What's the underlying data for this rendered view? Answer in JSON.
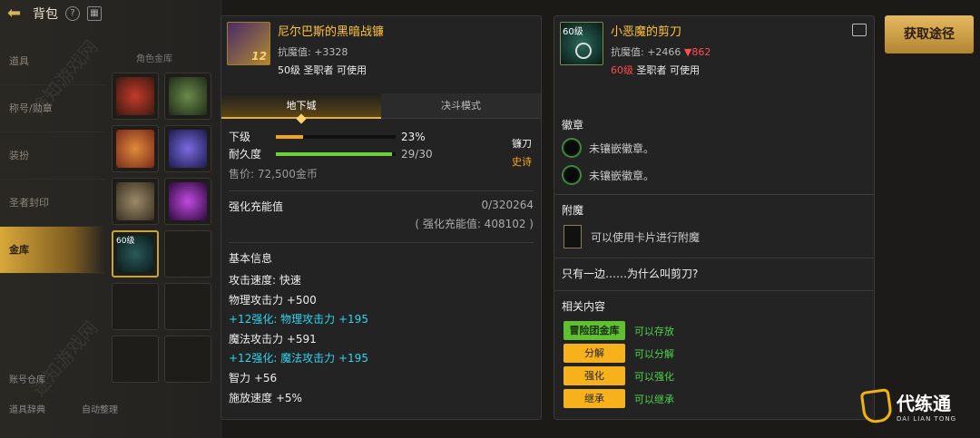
{
  "inventory": {
    "title": "背包",
    "side_tabs": [
      "道具",
      "称号/勋章",
      "装扮",
      "圣者封印",
      "金库"
    ],
    "active_tab_index": 4,
    "grid_label": "角色金库",
    "selected_slot_level": "60级",
    "bottom_buttons": [
      "账号仓库",
      "道具辞典",
      "自动整理"
    ]
  },
  "item1": {
    "name": "尼尔巴斯的黑暗战镰",
    "enhance_level": "12",
    "magic_resist": "抗魔值: +3328",
    "requirement": "50级 圣职者 可使用",
    "tabs": [
      "地下城",
      "决斗模式"
    ],
    "active_tab": 0,
    "stats": {
      "grade_label": "下级",
      "grade_pct": "23%",
      "grade_fill": 0.23,
      "durability_label": "耐久度",
      "durability": "29/30",
      "durability_fill": 0.967
    },
    "weapon_type": "镰刀",
    "rarity": "史诗",
    "price": "售价: 72,500金币",
    "enhance_charge_label": "强化充能值",
    "enhance_charge_value": "0/320264",
    "enhance_charge_sub": "( 强化充能值: 408102 )",
    "basic_info_title": "基本信息",
    "basic_info": [
      {
        "text": "攻击速度: 快速",
        "cyan": false
      },
      {
        "text": "物理攻击力 +500",
        "cyan": false
      },
      {
        "text": "+12强化: 物理攻击力 +195",
        "cyan": true
      },
      {
        "text": "魔法攻击力 +591",
        "cyan": false
      },
      {
        "text": "+12强化: 魔法攻击力 +195",
        "cyan": true
      },
      {
        "text": "智力 +56",
        "cyan": false
      },
      {
        "text": "施放速度 +5%",
        "cyan": false
      }
    ]
  },
  "item2": {
    "level_badge": "60级",
    "name": "小恶魔的剪刀",
    "magic_resist": "抗魔值: +2466",
    "magic_resist_down": "▼862",
    "requirement_level": "60级",
    "requirement_rest": " 圣职者 可使用",
    "emblem_title": "徽章",
    "emblems": [
      "未镶嵌徽章。",
      "未镶嵌徽章。"
    ],
    "enchant_title": "附魔",
    "enchant_text": "可以使用卡片进行附魔",
    "flavor": "只有一边……为什么叫剪刀?",
    "related_title": "相关内容",
    "related": [
      {
        "btn": "冒险团金库",
        "text": "可以存放",
        "green": true
      },
      {
        "btn": "分解",
        "text": "可以分解",
        "green": false
      },
      {
        "btn": "强化",
        "text": "可以强化",
        "green": false
      },
      {
        "btn": "继承",
        "text": "可以继承",
        "green": false
      }
    ]
  },
  "acquire_button": "获取途径",
  "logo": {
    "title": "代练通",
    "subtitle": "DAI LIAN TONG"
  },
  "watermark": "途知游戏网"
}
